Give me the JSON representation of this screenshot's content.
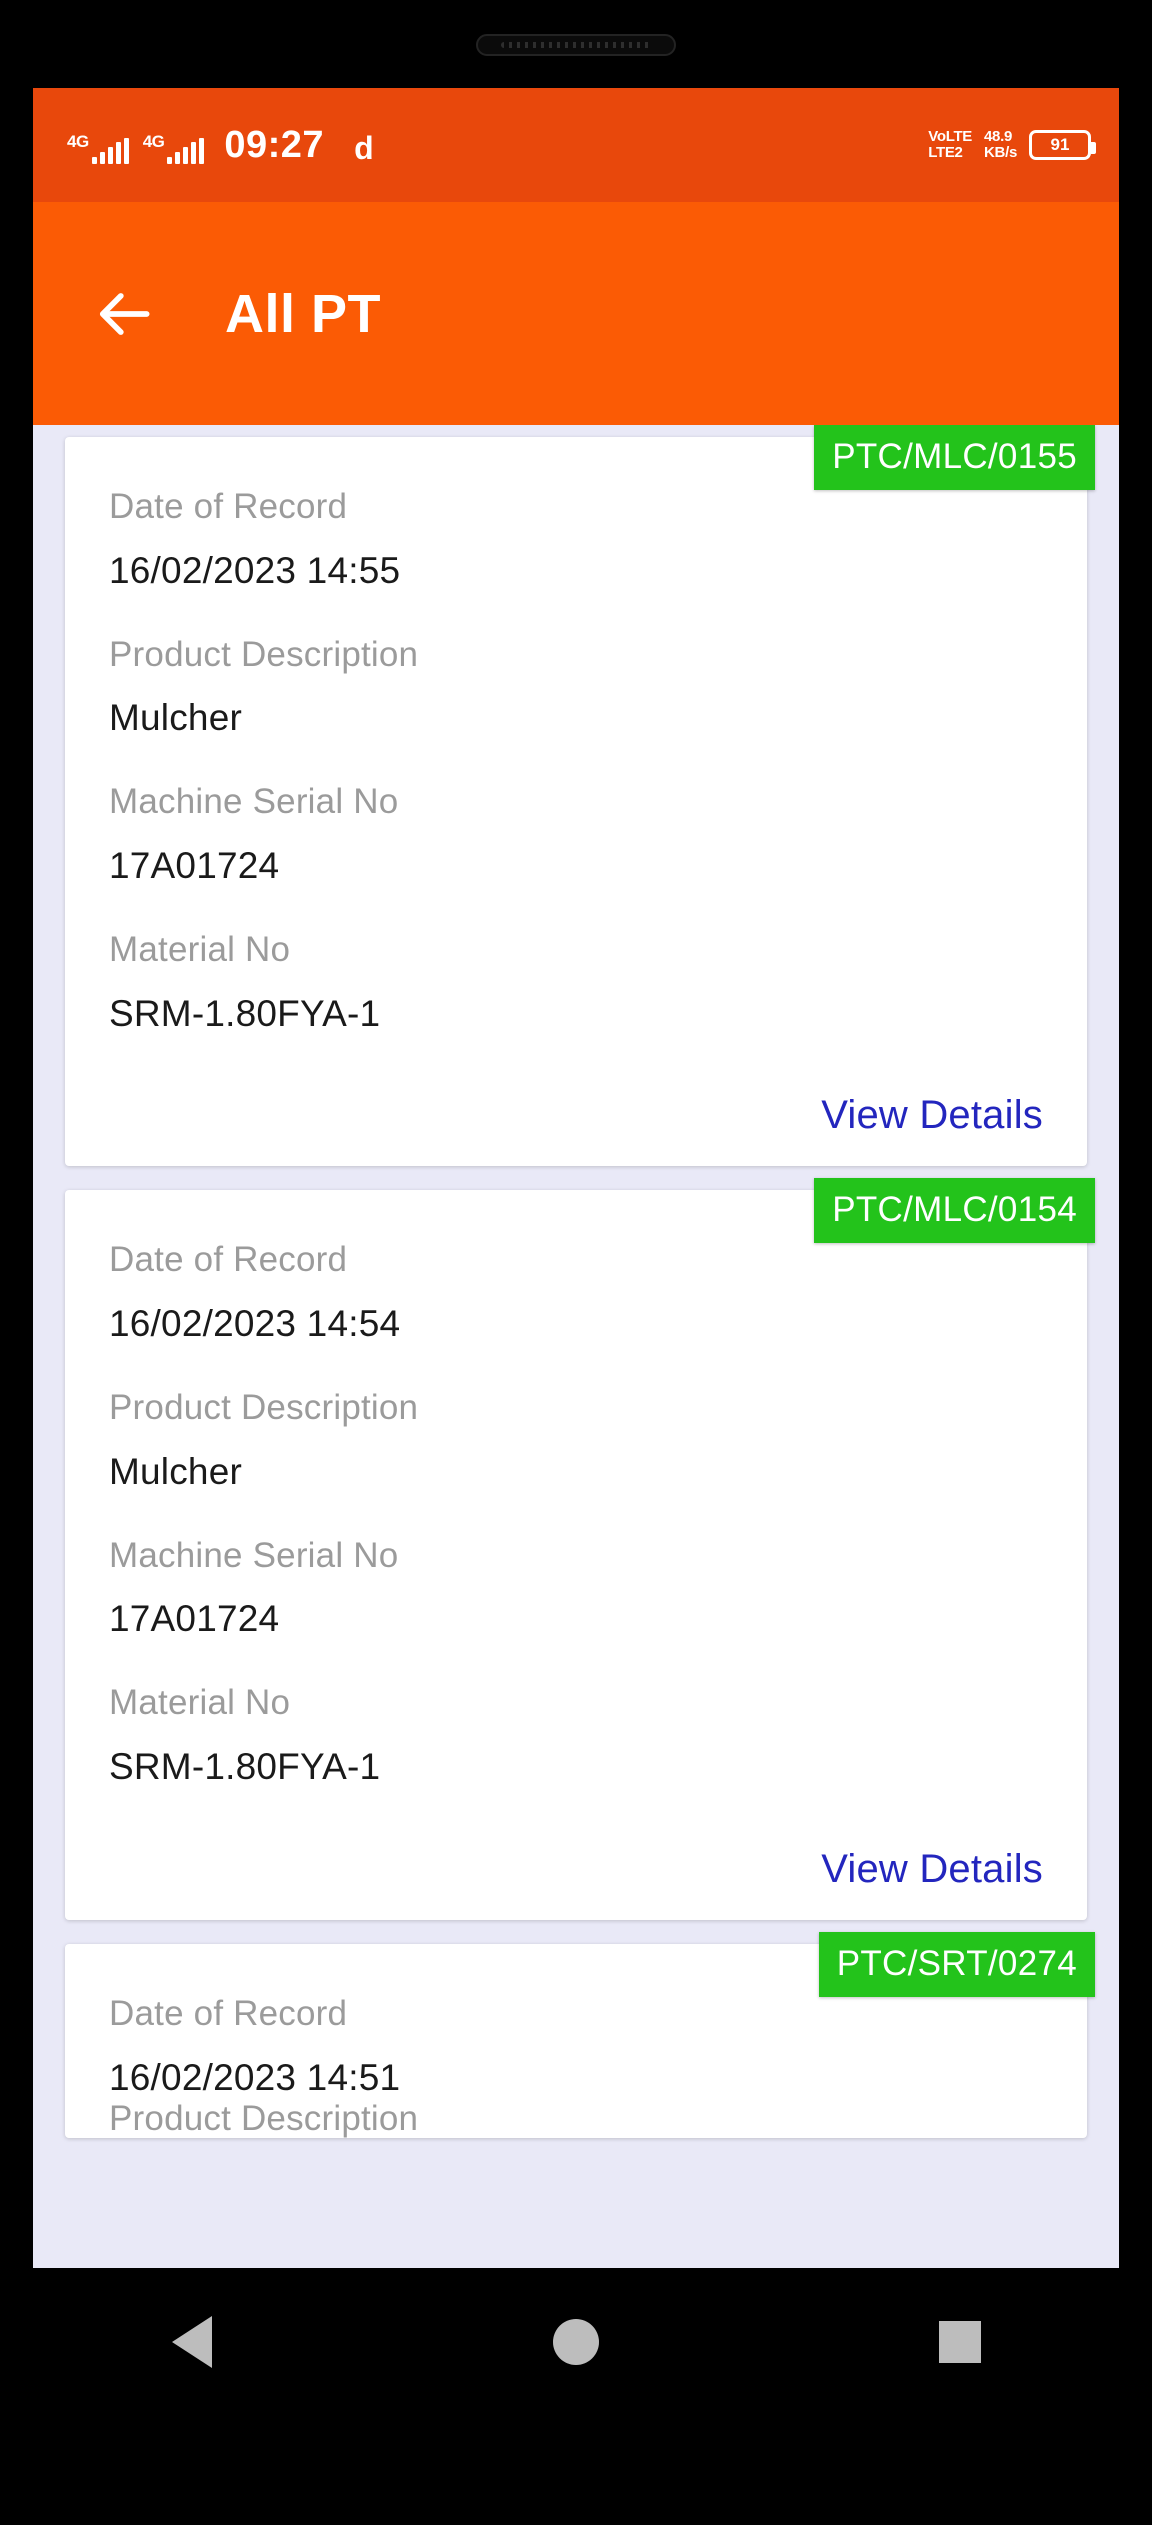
{
  "status_bar": {
    "network_label_1": "4G",
    "network_label_2": "4G",
    "time": "09:27",
    "extra_indicator": "d",
    "volte_line1": "VoLTE",
    "volte_line2": "LTE2",
    "datarate_value": "48.9",
    "datarate_unit": "KB/s",
    "battery_level": "91",
    "bg_color": "#E8480C"
  },
  "app_bar": {
    "back_icon": "arrow-left-icon",
    "title": "All PT",
    "bg_color": "#FB5B05"
  },
  "content": {
    "bg_color": "#E9E9F7",
    "labels": {
      "date_of_record": "Date of Record",
      "product_description": "Product Description",
      "machine_serial_no": "Machine Serial No",
      "material_no": "Material No"
    },
    "view_details_label": "View Details",
    "view_details_color": "#2326BE",
    "badge_color": "#23C31B",
    "cards": [
      {
        "badge": "PTC/MLC/0155",
        "date_of_record": "16/02/2023 14:55",
        "product_description": "Mulcher",
        "machine_serial_no": "17A01724",
        "material_no": "SRM-1.80FYA-1"
      },
      {
        "badge": "PTC/MLC/0154",
        "date_of_record": "16/02/2023 14:54",
        "product_description": "Mulcher",
        "machine_serial_no": "17A01724",
        "material_no": "SRM-1.80FYA-1"
      },
      {
        "badge": "PTC/SRT/0274",
        "date_of_record": "16/02/2023 14:51",
        "product_description": "",
        "machine_serial_no": "",
        "material_no": ""
      }
    ]
  },
  "nav_bar": {
    "back_icon": "triangle-back-icon",
    "home_icon": "circle-home-icon",
    "recents_icon": "square-recents-icon"
  }
}
